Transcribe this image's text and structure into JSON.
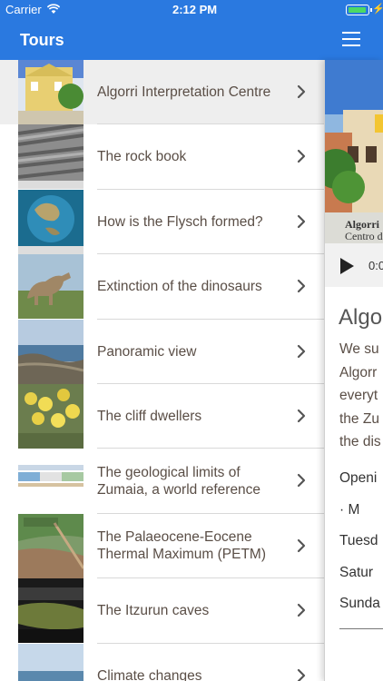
{
  "status_bar": {
    "carrier": "Carrier",
    "time": "2:12 PM"
  },
  "nav": {
    "title": "Tours"
  },
  "tours": [
    {
      "label": "Algorri Interpretation Centre",
      "thumb": "centre",
      "selected": true
    },
    {
      "label": "The rock book",
      "thumb": "rock"
    },
    {
      "label": "How is the Flysch formed?",
      "thumb": "globe"
    },
    {
      "label": "Extinction of the dinosaurs",
      "thumb": "dino"
    },
    {
      "label": "Panoramic view",
      "thumb": "coast"
    },
    {
      "label": "The cliff dwellers",
      "thumb": "flowers"
    },
    {
      "label": "The geological limits of Zumaia, a world reference",
      "thumb": "chart"
    },
    {
      "label": "The Palaeocene-Eocene Thermal Maximum (PETM)",
      "thumb": "eocene"
    },
    {
      "label": "The Itzurun caves",
      "thumb": "cave"
    },
    {
      "label": "Climate changes",
      "thumb": "sea"
    }
  ],
  "detail": {
    "hero_caption_1": "Algorri",
    "hero_caption_2": "Centro d",
    "player_time": "0:0",
    "title": "Algo",
    "paragraph_lines": [
      "We su",
      "Algorr",
      "everyt",
      "the Zu",
      "the dis"
    ],
    "hours_lines": [
      "Openi",
      "·      M",
      "Tuesd",
      "Satur",
      "Sunda"
    ]
  },
  "colors": {
    "brand_blue": "#2a79e0",
    "text": "#5a4e46"
  }
}
